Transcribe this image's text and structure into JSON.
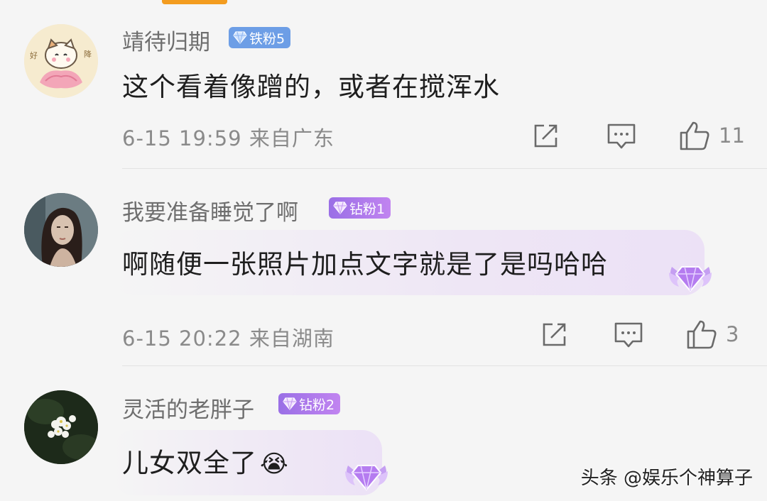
{
  "comments": [
    {
      "username": "靖待归期",
      "badge": "铁粉5",
      "badge_type": "iron",
      "text": "这个看着像蹭的，或者在搅浑水",
      "meta": "6-15 19:59 来自广东",
      "likes": "11"
    },
    {
      "username": "我要准备睡觉了啊",
      "badge": "钻粉1",
      "badge_type": "diamond",
      "text": "啊随便一张照片加点文字就是了是吗哈哈",
      "meta": "6-15 20:22 来自湖南",
      "likes": "3"
    },
    {
      "username": "灵活的老胖子",
      "badge": "钻粉2",
      "badge_type": "diamond",
      "text": "儿女双全了",
      "emoji": "😭"
    }
  ],
  "watermark": "头条 @娱乐个神算子",
  "colors": {
    "iron_badge": "#6d9ee6",
    "diamond_badge": "#b07ceb",
    "accent_tab": "#f39c1f"
  },
  "icons": [
    "share-icon",
    "comment-icon",
    "like-icon",
    "diamond-wing-badge-icon",
    "crying-emoji-icon"
  ]
}
